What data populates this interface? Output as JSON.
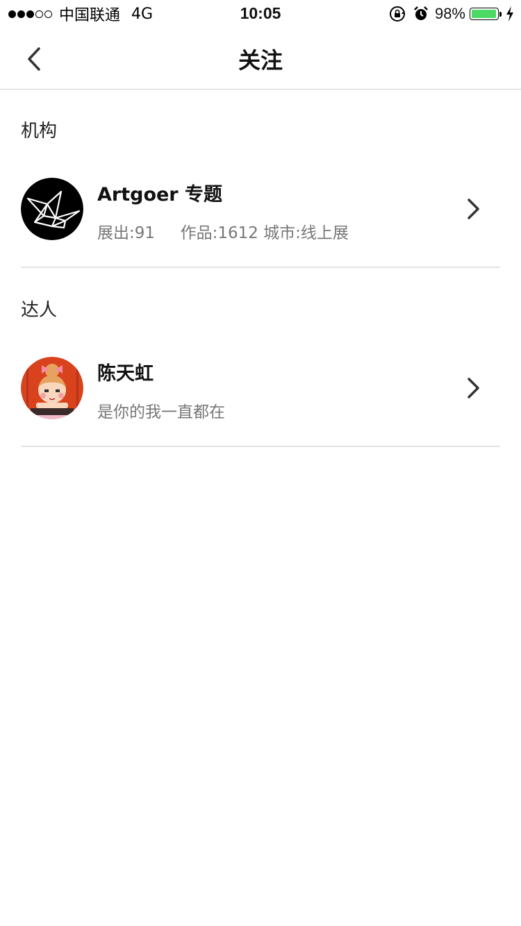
{
  "status_bar": {
    "carrier": "中国联通",
    "network": "4G",
    "time": "10:05",
    "battery_percent": "98%",
    "battery_level": 0.98,
    "battery_color": "#4cd964",
    "signal_bars_filled": 3,
    "signal_bars_total": 5,
    "icons": [
      "orientation-lock-icon",
      "alarm-icon",
      "charging-bolt-icon"
    ]
  },
  "nav": {
    "title": "关注",
    "back_icon": "chevron-left-icon"
  },
  "sections": {
    "institutions": {
      "title": "机构",
      "items": [
        {
          "name": "Artgoer 专题",
          "subtitle": "展出:91     作品:1612 城市:线上展",
          "avatar": "paper-crane-logo",
          "chevron_icon": "chevron-right-icon"
        }
      ]
    },
    "experts": {
      "title": "达人",
      "items": [
        {
          "name": "陈天虹",
          "subtitle": "是你的我一直都在",
          "avatar": "cartoon-girl-avatar",
          "chevron_icon": "chevron-right-icon"
        }
      ]
    }
  }
}
